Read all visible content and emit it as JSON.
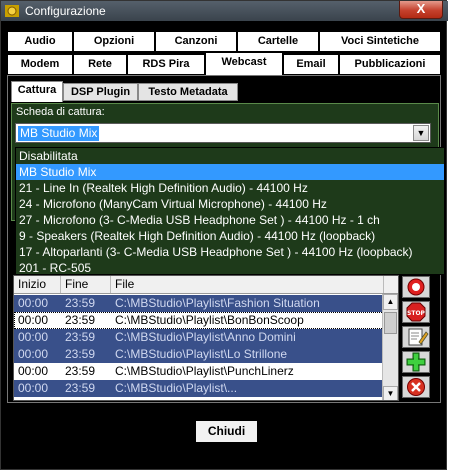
{
  "window": {
    "title": "Configurazione",
    "close_label": "X"
  },
  "tabs_row1": [
    "Audio",
    "Opzioni",
    "Canzoni",
    "Cartelle",
    "Voci Sintetiche"
  ],
  "tabs_row2": [
    "Modem",
    "Rete",
    "RDS Pira",
    "Webcast",
    "Email",
    "Pubblicazioni"
  ],
  "active_tab": "Webcast",
  "subtabs": [
    "Cattura",
    "DSP Plugin",
    "Testo Metadata"
  ],
  "active_subtab": "Cattura",
  "capture": {
    "label": "Scheda di cattura:",
    "selected_value": "MB Studio Mix",
    "options": [
      "Disabilitata",
      "MB Studio Mix",
      "21 - Line In (Realtek High Definition Audio) - 44100 Hz",
      "24 - Microfono (ManyCam Virtual Microphone) - 44100 Hz",
      "27 - Microfono (3- C-Media USB Headphone Set  ) - 44100 Hz - 1 ch",
      "9 - Speakers (Realtek High Definition Audio) - 44100 Hz (loopback)",
      "17 - Altoparlanti (3- C-Media USB Headphone Set  ) - 44100 Hz (loopback)",
      "201 - RC-505"
    ]
  },
  "playlist": {
    "columns": [
      "Inizio",
      "Fine",
      "File"
    ],
    "rows": [
      [
        "00:00",
        "23:59",
        "C:\\MBStudio\\Playlist\\Fashion Situation"
      ],
      [
        "00:00",
        "23:59",
        "C:\\MBStudio\\Playlist\\BonBonScoop"
      ],
      [
        "00:00",
        "23:59",
        "C:\\MBStudio\\Playlist\\Anno Domini"
      ],
      [
        "00:00",
        "23:59",
        "C:\\MBStudio\\Playlist\\Lo Strillone"
      ],
      [
        "00:00",
        "23:59",
        "C:\\MBStudio\\Playlist\\PunchLinerz"
      ],
      [
        "00:00",
        "23:59",
        "C:\\MBStudio\\Playlist\\..."
      ]
    ]
  },
  "side_buttons": [
    "record-icon",
    "stop-sign-icon",
    "edit-icon",
    "add-icon",
    "delete-icon"
  ],
  "stop_label": "STOP",
  "close_button_label": "Chiudi",
  "colors": {
    "panel_green": "#1e3a1a",
    "selection_blue": "#3399ff",
    "row_blue": "#39508a",
    "close_red": "#c5412d"
  }
}
